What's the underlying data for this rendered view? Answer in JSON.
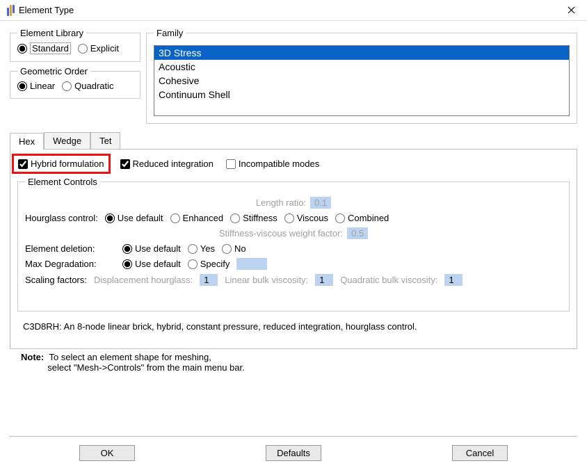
{
  "window": {
    "title": "Element Type"
  },
  "element_library": {
    "legend": "Element Library",
    "standard": "Standard",
    "explicit": "Explicit"
  },
  "geometric_order": {
    "legend": "Geometric Order",
    "linear": "Linear",
    "quadratic": "Quadratic"
  },
  "family": {
    "legend": "Family",
    "items": [
      "3D Stress",
      "Acoustic",
      "Cohesive",
      "Continuum Shell"
    ]
  },
  "tabs": {
    "hex": "Hex",
    "wedge": "Wedge",
    "tet": "Tet"
  },
  "checks": {
    "hybrid": "Hybrid formulation",
    "reduced": "Reduced integration",
    "incompatible": "Incompatible modes"
  },
  "controls": {
    "legend": "Element Controls",
    "length_ratio_label": "Length ratio:",
    "length_ratio_val": "0.1",
    "hourglass_label": "Hourglass control:",
    "hg_default": "Use default",
    "hg_enhanced": "Enhanced",
    "hg_stiffness": "Stiffness",
    "hg_viscous": "Viscous",
    "hg_combined": "Combined",
    "svwf_label": "Stiffness-viscous weight factor:",
    "svwf_val": "0.5",
    "deletion_label": "Element deletion:",
    "del_default": "Use default",
    "del_yes": "Yes",
    "del_no": "No",
    "degrade_label": "Max Degradation:",
    "deg_default": "Use default",
    "deg_specify": "Specify",
    "scaling_label": "Scaling factors:",
    "sf_disp": "Displacement hourglass:",
    "sf_linear": "Linear bulk viscosity:",
    "sf_quad": "Quadratic bulk viscosity:",
    "sf_val": "1"
  },
  "description": "C3D8RH:  An 8-node linear brick, hybrid, constant pressure, reduced integration, hourglass control.",
  "note": {
    "label": "Note:",
    "line1": "To select an element shape for meshing,",
    "line2": "select \"Mesh->Controls\" from the main menu bar."
  },
  "buttons": {
    "ok": "OK",
    "defaults": "Defaults",
    "cancel": "Cancel"
  }
}
